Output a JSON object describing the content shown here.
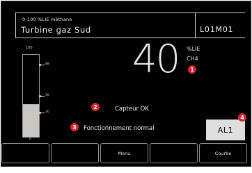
{
  "header": {
    "subtitle": "0-100 %LIE méthane",
    "title": "Turbine gaz Sud",
    "code": "L01M01"
  },
  "reading": {
    "value": "40",
    "unit": "%LIE",
    "gas": "CH4"
  },
  "gauge": {
    "min_label": "0",
    "max_label": "100",
    "level_percent": 40,
    "ticks": [
      {
        "label": "88",
        "percent": 88
      },
      {
        "label": "50",
        "percent": 50
      },
      {
        "label": "30",
        "percent": 30
      }
    ]
  },
  "status": {
    "sensor": "Capteur OK",
    "operation": "Fonctionnement normal"
  },
  "alarm": {
    "label": "AL1"
  },
  "badges": [
    "1",
    "2",
    "3",
    "4"
  ],
  "softkeys": [
    "",
    "",
    "Menu",
    "",
    "Courbe"
  ],
  "colors": {
    "screen_bg": "#000000",
    "text": "#ececec",
    "badge": "#d4262c",
    "gauge_fill": "#c8c8c0",
    "alarm_button": "#dedede"
  }
}
